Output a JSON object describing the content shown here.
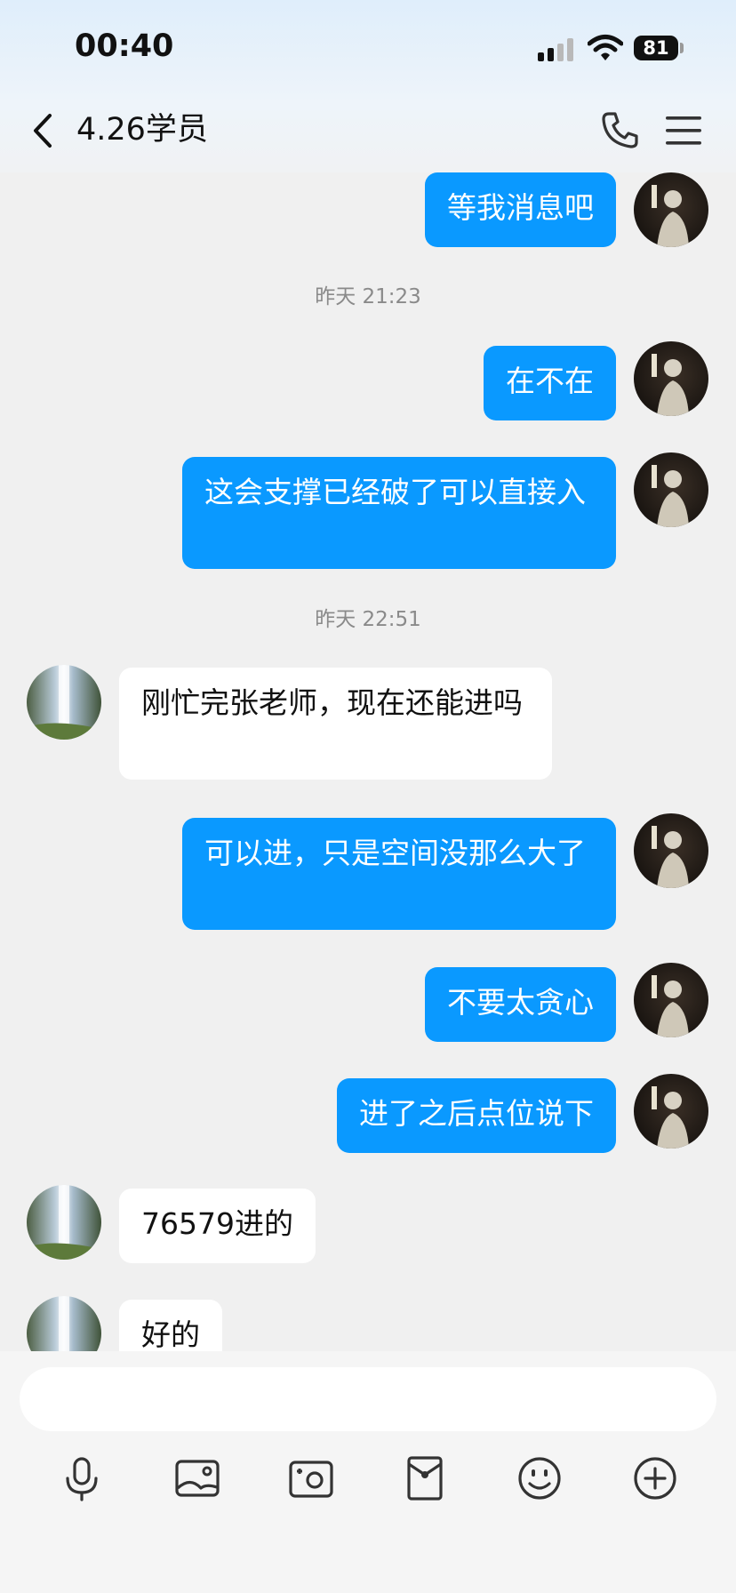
{
  "status_bar": {
    "time": "00:40",
    "battery": "81"
  },
  "header": {
    "title": "4.26学员"
  },
  "chat": {
    "timestamps": [
      "昨天 21:23",
      "昨天 22:51"
    ],
    "messages": [
      {
        "from": "me",
        "text": "等我消息吧"
      },
      {
        "from": "me",
        "text": "在不在"
      },
      {
        "from": "me",
        "text": "这会支撑已经破了可以直接入"
      },
      {
        "from": "them",
        "text": "刚忙完张老师，现在还能进吗"
      },
      {
        "from": "me",
        "text": "可以进，只是空间没那么大了"
      },
      {
        "from": "me",
        "text": "不要太贪心"
      },
      {
        "from": "me",
        "text": "进了之后点位说下"
      },
      {
        "from": "them",
        "text": "76579进的"
      },
      {
        "from": "them",
        "text": "好的"
      }
    ]
  },
  "composer": {
    "input_value": "",
    "tools": [
      "microphone-icon",
      "image-icon",
      "camera-icon",
      "red-packet-icon",
      "emoji-icon",
      "plus-icon"
    ]
  },
  "colors": {
    "outgoing_bubble": "#0a99ff",
    "incoming_bubble": "#ffffff",
    "background": "#f0f0f0"
  }
}
